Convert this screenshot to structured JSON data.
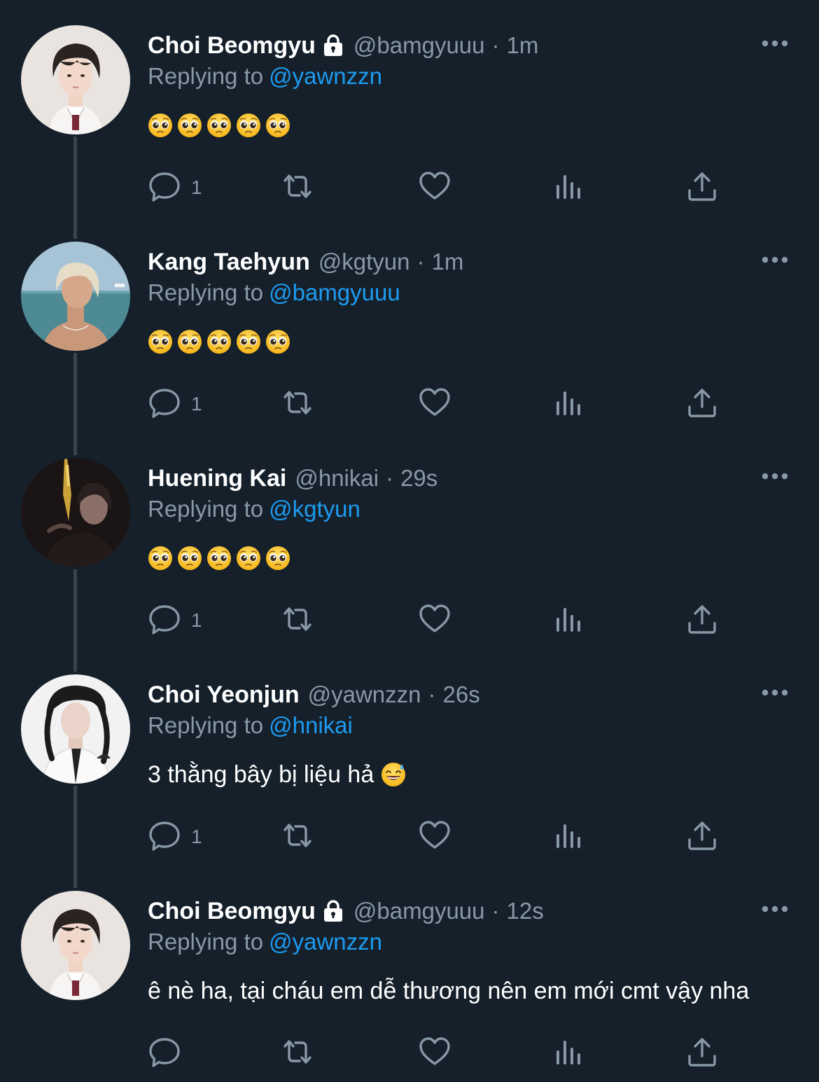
{
  "colors": {
    "background": "#15202b",
    "secondary_text": "#8899a6",
    "link": "#1d9bf0",
    "thread_line": "#38444d"
  },
  "tweets": [
    {
      "name": "Choi Beomgyu",
      "protected": true,
      "handle": "@bamgyuuu",
      "sep": "·",
      "time": "1m",
      "replying_label": "Replying to",
      "replying_to": "@yawnzzn",
      "emoji_count": 5,
      "text": "",
      "reply_count": "1",
      "avatar_style": "light-portrait"
    },
    {
      "name": "Kang Taehyun",
      "protected": false,
      "handle": "@kgtyun",
      "sep": "·",
      "time": "1m",
      "replying_label": "Replying to",
      "replying_to": "@bamgyuuu",
      "emoji_count": 5,
      "text": "",
      "reply_count": "1",
      "avatar_style": "beach-portrait"
    },
    {
      "name": "Huening Kai",
      "protected": false,
      "handle": "@hnikai",
      "sep": "·",
      "time": "29s",
      "replying_label": "Replying to",
      "replying_to": "@kgtyun",
      "emoji_count": 5,
      "text": "",
      "reply_count": "1",
      "avatar_style": "night-portrait"
    },
    {
      "name": "Choi Yeonjun",
      "protected": false,
      "handle": "@yawnzzn",
      "sep": "·",
      "time": "26s",
      "replying_label": "Replying to",
      "replying_to": "@hnikai",
      "emoji_count": 0,
      "text": "3 thằng bây bị liệu hả",
      "trailing_emoji": "grinning-sweat-emoji",
      "reply_count": "1",
      "avatar_style": "suit-portrait"
    },
    {
      "name": "Choi Beomgyu",
      "protected": true,
      "handle": "@bamgyuuu",
      "sep": "·",
      "time": "12s",
      "replying_label": "Replying to",
      "replying_to": "@yawnzzn",
      "emoji_count": 0,
      "text": "ê nè ha, tại cháu em dễ thương nên em mới cmt vậy nha",
      "reply_count": "",
      "avatar_style": "light-portrait"
    }
  ]
}
